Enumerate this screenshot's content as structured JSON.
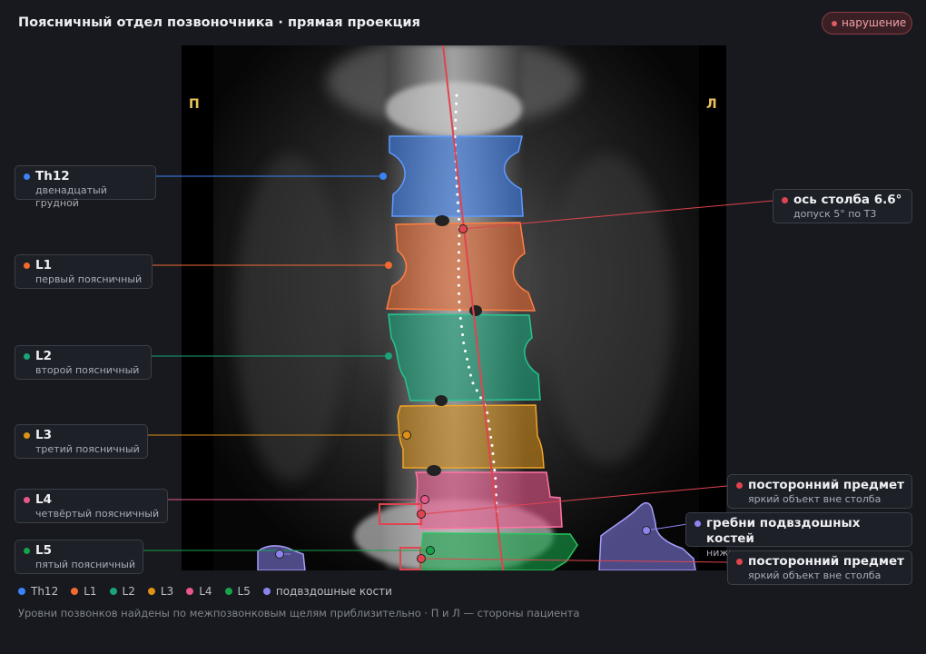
{
  "header": {
    "title": "Поясничный отдел позвоночника · прямая проекция",
    "badge": "нарушение"
  },
  "viewer": {
    "side_right_patient": "П",
    "side_left_patient": "Л"
  },
  "vertebrae": [
    {
      "id": "th12",
      "label": "Th12",
      "sub": "двенадцатый грудной",
      "color": "#3b82f6"
    },
    {
      "id": "l1",
      "label": "L1",
      "sub": "первый поясничный",
      "color": "#f26a2e"
    },
    {
      "id": "l2",
      "label": "L2",
      "sub": "второй поясничный",
      "color": "#19a37a"
    },
    {
      "id": "l3",
      "label": "L3",
      "sub": "третий поясничный",
      "color": "#dd9216"
    },
    {
      "id": "l4",
      "label": "L4",
      "sub": "четвёртый поясничный",
      "color": "#e8578a"
    },
    {
      "id": "l5",
      "label": "L5",
      "sub": "пятый поясничный",
      "color": "#16a34a"
    }
  ],
  "findings": [
    {
      "id": "axis",
      "label": "ось столба 6.6°",
      "sub": "допуск 5° по Т3",
      "color": "#e0444f"
    },
    {
      "id": "foreign1",
      "label": "посторонний предмет",
      "sub": "яркий объект вне столба",
      "color": "#e0444f"
    },
    {
      "id": "iliac",
      "label": "гребни подвздошных костей",
      "sub": "нижняя граница охвата",
      "color": "#8b84f0"
    },
    {
      "id": "foreign2",
      "label": "посторонний предмет",
      "sub": "яркий объект вне столба",
      "color": "#e0444f"
    }
  ],
  "legend": [
    {
      "label": "Th12",
      "color": "#3b82f6"
    },
    {
      "label": "L1",
      "color": "#f26a2e"
    },
    {
      "label": "L2",
      "color": "#19a37a"
    },
    {
      "label": "L3",
      "color": "#dd9216"
    },
    {
      "label": "L4",
      "color": "#e8578a"
    },
    {
      "label": "L5",
      "color": "#16a34a"
    },
    {
      "label": "подвздошные кости",
      "color": "#8b84f0"
    }
  ],
  "footer": "Уровни позвонков найдены по межпозвонковым щелям приблизительно · П и Л — стороны пациента"
}
